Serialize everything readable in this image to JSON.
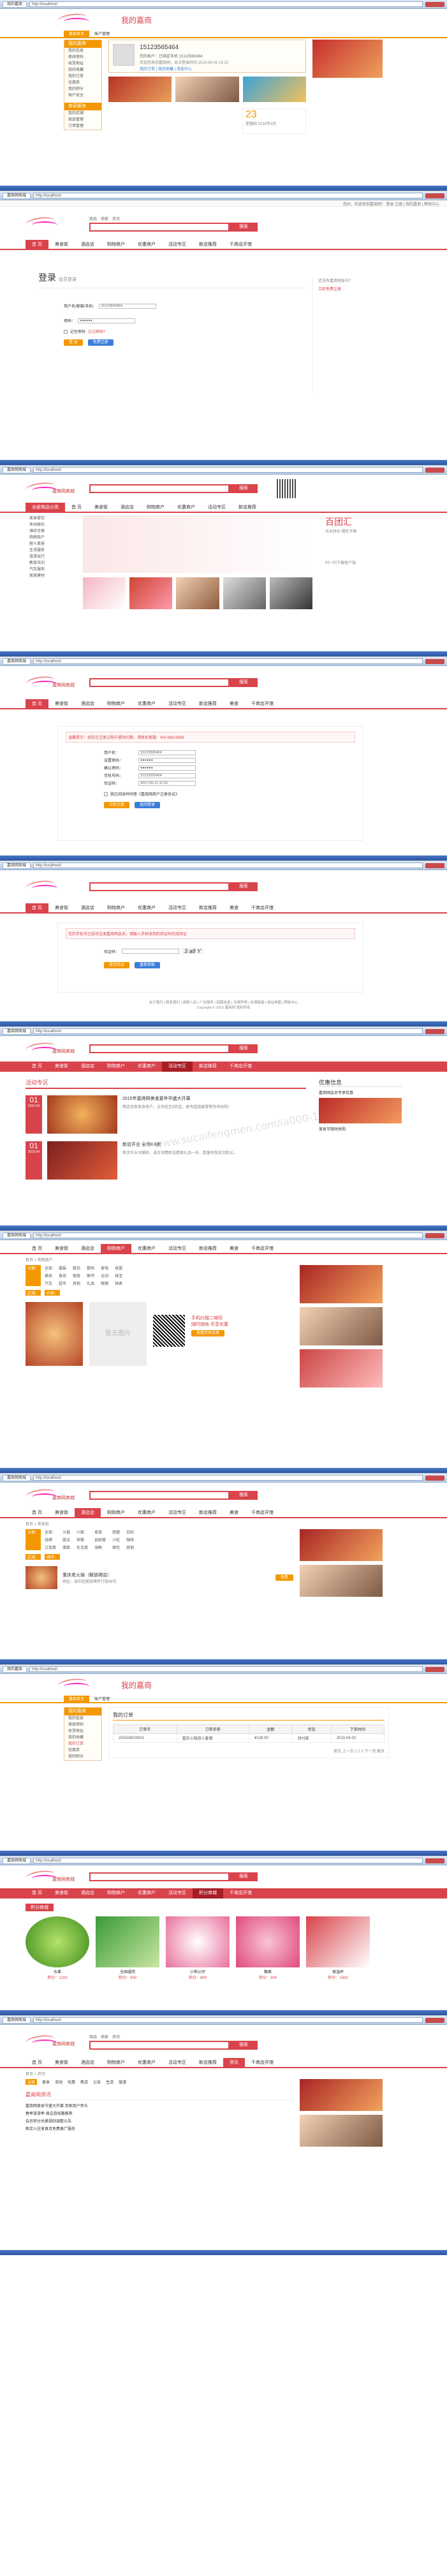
{
  "browser": {
    "tab_title": "我的嘉商",
    "address": "http://localhost/"
  },
  "site": {
    "logo_text": "嘉商网商城",
    "top_right": "您好，欢迎来到嘉商网！ 登录 注册 | 我的嘉商 | 帮助中心",
    "search_tabs": [
      "商品",
      "商家",
      "资讯"
    ],
    "search_button": "搜索",
    "hot_words": "热门搜索：美食 酒店 KTV 电影"
  },
  "nav": {
    "items": [
      "首页",
      "美食",
      "休闲娱乐",
      "酒店",
      "购物",
      "丽人",
      "生活服务",
      "团购"
    ],
    "items_alt": [
      "首 页",
      "美食街",
      "酒店店",
      "购物商户",
      "优惠商户",
      "活动专区",
      "新店推荐",
      "美食",
      "千商店开馆"
    ]
  },
  "s1": {
    "title": "我的嘉商",
    "tabs": [
      "嘉商首页",
      "账户管理"
    ],
    "side_title": "我的嘉商",
    "side_items": [
      "我的信息",
      "修改密码",
      "收货地址",
      "我的收藏",
      "我的订单",
      "优惠券",
      "我的积分",
      "账户安全"
    ],
    "side2_title": "商家服务",
    "side2_items": [
      "我的店铺",
      "商品管理",
      "订单管理"
    ],
    "account": "15123565464",
    "account_desc": "您的账户：已绑定手机 15123565464",
    "welcome": "欢迎您来到嘉商网，本次登录时间 2015-04-02 14:32",
    "links": "我的订单 | 我的收藏 | 消息中心",
    "date_num": "23",
    "date_label": "星期四 2015年4月"
  },
  "s2": {
    "login_title": "登录",
    "login_sub": "会员登录",
    "user_label": "用户名/邮箱/手机：",
    "user_value": "15123565464",
    "pwd_label": "密码：",
    "pwd_value": "●●●●●●",
    "remember": "记住密码",
    "forgot": "忘记密码？",
    "login_btn": "登 录",
    "reg_btn": "免费注册",
    "right_note": "还没有嘉商网账号？",
    "right_link": "立即免费注册"
  },
  "s3": {
    "side_title": "全部商品分类",
    "side_items": [
      "美食餐饮",
      "休闲娱乐",
      "酒店住宿",
      "购物商户",
      "丽人美容",
      "生活服务",
      "旅游出行",
      "教育培训",
      "汽车服务",
      "家居建材"
    ],
    "promo": "百团汇",
    "promo_sub": "天天特价 精彩不断",
    "qr_label": "扫一扫下载客户端"
  },
  "s4": {
    "notice": "温馨提示：如您在注册过程中遇到问题，请联系客服：400-888-8888",
    "rows": [
      {
        "label": "用户名：",
        "value": "15123565464"
      },
      {
        "label": "设置密码：",
        "value": "●●●●●●"
      },
      {
        "label": "确认密码：",
        "value": "●●●●●●"
      },
      {
        "label": "手机号码：",
        "value": "15123565464"
      },
      {
        "label": "验证码：",
        "value": "2017-05-12 11:32"
      }
    ],
    "agree": "我已阅读并同意《嘉商网用户注册协议》",
    "submit": "立即注册",
    "back": "返回登录"
  },
  "s5": {
    "notice": "您的手机号已成功注册嘉商网会员，请输入手机收到的验证码完成验证",
    "code_label": "验证码：",
    "code_value": "3 a8 Y",
    "btn1": "提交验证",
    "btn2": "重新获取",
    "footer": "关于我们 | 联系我们 | 商家入驻 | 广告服务 | 招聘信息 | 法律声明 | 友情链接 | 网站地图 | 帮助中心",
    "copyright": "Copyright © 2015 嘉商网 版权所有"
  },
  "s6": {
    "section_title": "活动专区",
    "right_title": "优惠信息",
    "watermark": "www.sucaifengmen.com/ia000-1684",
    "items": [
      {
        "date": "01",
        "month": "2015-04",
        "title": "2015年嘉商网美食嘉年华盛大开幕",
        "desc": "精选百家美食商户，全场低至5折起，更有超值套餐等你来抢购！"
      },
      {
        "date": "01",
        "month": "2015-04",
        "title": "新店开业 全场8.8折",
        "desc": "新店开业大酬宾，进店消费即送精美礼品一份，数量有限送完即止。"
      }
    ],
    "right_items": [
      "嘉商网会员专享优惠",
      "美食节限时抢购"
    ]
  },
  "s7": {
    "breadcrumb": "首页 > 购物商户",
    "filter_labels": [
      "分类：",
      "区域：",
      "价格："
    ],
    "cats": [
      "全部",
      "服装",
      "鞋包",
      "数码",
      "家电",
      "母婴",
      "美妆",
      "食品",
      "家居",
      "图书",
      "运动",
      "珠宝",
      "汽车",
      "超市",
      "其他",
      "礼品",
      "眼镜",
      "钟表"
    ],
    "promo_title": "手机扫描二维码",
    "promo_sub": "随时随地 尽享优惠",
    "promo_btn": "查看所有优惠",
    "img_label": "暂无图片"
  },
  "s8": {
    "breadcrumb": "首页 > 美食街",
    "filter_labels": [
      "分类：",
      "区域：",
      "排序："
    ],
    "cats": [
      "全部",
      "火锅",
      "川菜",
      "粤菜",
      "西餐",
      "日料",
      "烧烤",
      "甜点",
      "快餐",
      "自助餐",
      "小吃",
      "咖啡",
      "江浙菜",
      "湘菜",
      "东北菜",
      "海鲜",
      "面包",
      "其他"
    ],
    "shop_name": "重庆老火锅（解放碑店）",
    "shop_desc": "地址：渝中区解放碑步行街88号",
    "shop_btn": "查看"
  },
  "s9": {
    "title": "我的嘉商",
    "tabs": [
      "嘉商首页",
      "账户管理"
    ],
    "side_title": "我的嘉商",
    "side_items": [
      "我的信息",
      "修改密码",
      "收货地址",
      "我的收藏",
      "我的订单",
      "优惠券",
      "我的积分"
    ],
    "table_title": "我的订单",
    "headers": [
      "订单号",
      "订单名称",
      "金额",
      "状态",
      "下单时间"
    ],
    "row": [
      "201504020001",
      "重庆火锅双人套餐",
      "¥128.00",
      "待付款",
      "2015-04-02"
    ],
    "pager": "首页 上一页 1 2 3 下一页 尾页"
  },
  "s10": {
    "section_title": "积分商城",
    "products": [
      {
        "name": "水果",
        "points": "积分：1200"
      },
      {
        "name": "全国通用",
        "points": "积分：500"
      },
      {
        "name": "小熊公仔",
        "points": "积分：800"
      },
      {
        "name": "糖果",
        "points": "积分：300"
      },
      {
        "name": "保温杯",
        "points": "积分：1500"
      }
    ]
  },
  "s11": {
    "breadcrumb": "首页 > 资讯",
    "cats": [
      "全部",
      "美食",
      "活动",
      "优惠",
      "新店",
      "公告",
      "生活",
      "旅游"
    ],
    "list_title": "嘉商网资讯",
    "news": [
      "嘉商网美食节盛大开幕 百家商户参与",
      "春季旅游季 周边游线路推荐",
      "会员积分兑换规则调整公告",
      "新店入驻享首月免费推广服务"
    ]
  }
}
